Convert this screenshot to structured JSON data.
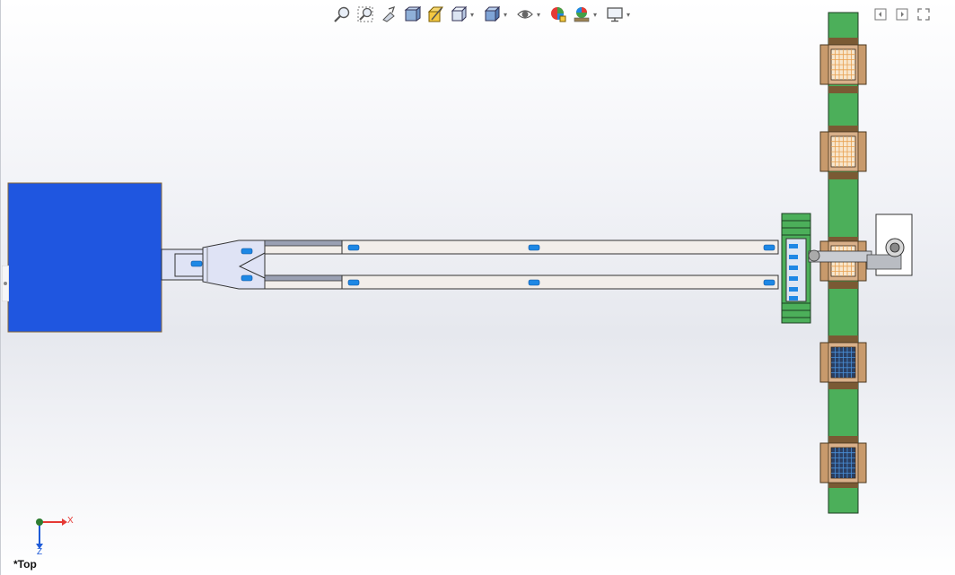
{
  "heads_up_toolbar": {
    "buttons": [
      {
        "name": "zoom-to-fit",
        "icon": "zoom-to-fit-icon",
        "has_dropdown": false
      },
      {
        "name": "zoom-to-area",
        "icon": "zoom-to-area-icon",
        "has_dropdown": false
      },
      {
        "name": "previous-view",
        "icon": "previous-view-icon",
        "has_dropdown": false
      },
      {
        "name": "section-view",
        "icon": "section-view-icon",
        "has_dropdown": false
      },
      {
        "name": "dynamic-annotation",
        "icon": "dynamic-annotation-icon",
        "has_dropdown": false
      },
      {
        "name": "view-orientation",
        "icon": "view-orientation-icon",
        "has_dropdown": true
      },
      {
        "name": "display-style",
        "icon": "display-style-icon",
        "has_dropdown": true
      },
      {
        "name": "hide-show-items",
        "icon": "hide-show-icon",
        "has_dropdown": true
      },
      {
        "name": "edit-appearance",
        "icon": "edit-appearance-icon",
        "has_dropdown": false
      },
      {
        "name": "apply-scene",
        "icon": "apply-scene-icon",
        "has_dropdown": true
      },
      {
        "name": "view-settings",
        "icon": "monitor-icon",
        "has_dropdown": true
      }
    ]
  },
  "window_controls": [
    {
      "name": "split-left",
      "icon": "split-left-icon"
    },
    {
      "name": "split-right",
      "icon": "split-right-icon"
    },
    {
      "name": "expand",
      "icon": "expand-icon"
    }
  ],
  "triad": {
    "x_label": "X",
    "z_label": "Z"
  },
  "view_label": "*Top",
  "colors": {
    "block": "#1f56e0",
    "conveyor_green": "#4caf5a",
    "station_brown": "#c89a6c",
    "station_orange": "#e8a050",
    "rail": "#f2eeea",
    "marker_blue": "#1e88e5",
    "triad_red": "#e53935",
    "triad_blue": "#1e5bd8",
    "triad_green": "#2e7d32"
  },
  "model": {
    "stations": [
      {
        "id": "station-1",
        "grid": "orange"
      },
      {
        "id": "station-2",
        "grid": "orange"
      },
      {
        "id": "station-3",
        "grid": "orange"
      },
      {
        "id": "station-4",
        "grid": "blue"
      },
      {
        "id": "station-5",
        "grid": "blue"
      }
    ]
  }
}
